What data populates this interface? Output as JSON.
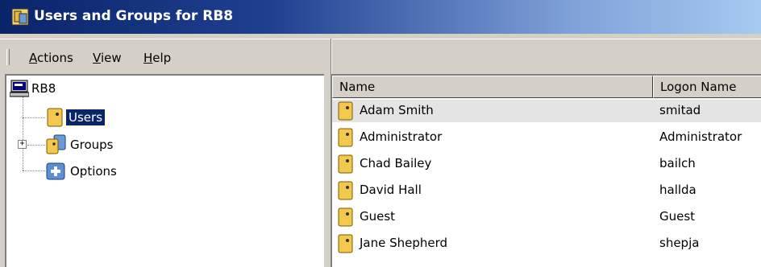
{
  "window": {
    "title": "Users and Groups for RB8"
  },
  "menu": {
    "items": [
      {
        "label": "Actions",
        "access_key": "A"
      },
      {
        "label": "View",
        "access_key": "V"
      },
      {
        "label": "Help",
        "access_key": "H"
      }
    ]
  },
  "tree": {
    "root": "RB8",
    "nodes": [
      {
        "label": "Users",
        "selected": true
      },
      {
        "label": "Groups",
        "expandable": true
      },
      {
        "label": "Options"
      }
    ]
  },
  "list": {
    "columns": [
      "Name",
      "Logon Name"
    ],
    "rows": [
      {
        "name": "Adam Smith",
        "logon": "smitad",
        "selected": true
      },
      {
        "name": "Administrator",
        "logon": "Administrator"
      },
      {
        "name": "Chad Bailey",
        "logon": "bailch"
      },
      {
        "name": "David Hall",
        "logon": "hallda"
      },
      {
        "name": "Guest",
        "logon": "Guest"
      },
      {
        "name": "Jane Shepherd",
        "logon": "shepja"
      }
    ]
  },
  "colors": {
    "title_start": "#0a246a",
    "title_end": "#a6caf0",
    "selection": "#0a246a",
    "user_icon": "#f2c94c"
  }
}
